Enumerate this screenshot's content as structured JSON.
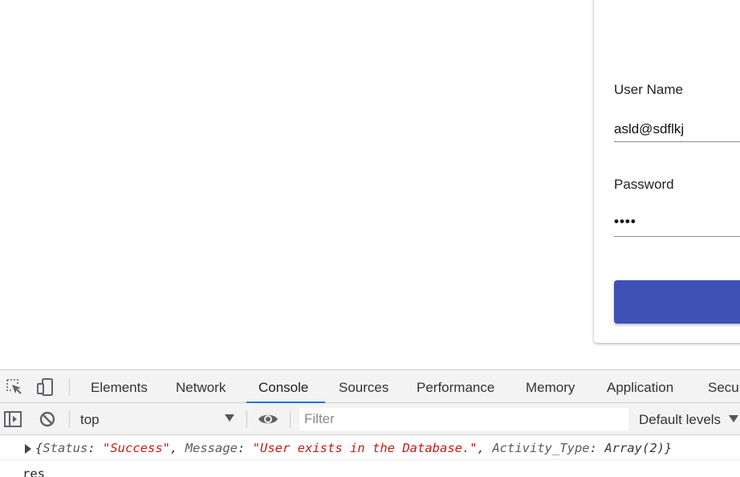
{
  "login": {
    "username_label": "User Name",
    "username_value": "asld@sdflkj",
    "password_label": "Password",
    "password_value": "••••",
    "primary_color": "#3f51b5"
  },
  "devtools": {
    "tabs": [
      "Elements",
      "Network",
      "Console",
      "Sources",
      "Performance",
      "Memory",
      "Application",
      "Secur"
    ],
    "active_tab": "Console",
    "accent_color": "#1a73e8",
    "icons": {
      "inspect": "inspect-element-icon",
      "device": "device-toolbar-icon",
      "sidebar": "show-sidebar-icon",
      "clear": "clear-console-icon",
      "eye": "live-expression-icon"
    },
    "console": {
      "context": "top",
      "filter_placeholder": "Filter",
      "levels": "Default levels",
      "log": {
        "open_brace": "{",
        "k1": "Status",
        "v1": "\"Success\"",
        "k2": "Message",
        "v2": "\"User exists in the Database.\"",
        "k3": "Activity_Type",
        "v3": "Array(2)",
        "close_brace": "}"
      },
      "input_text": "res"
    }
  }
}
